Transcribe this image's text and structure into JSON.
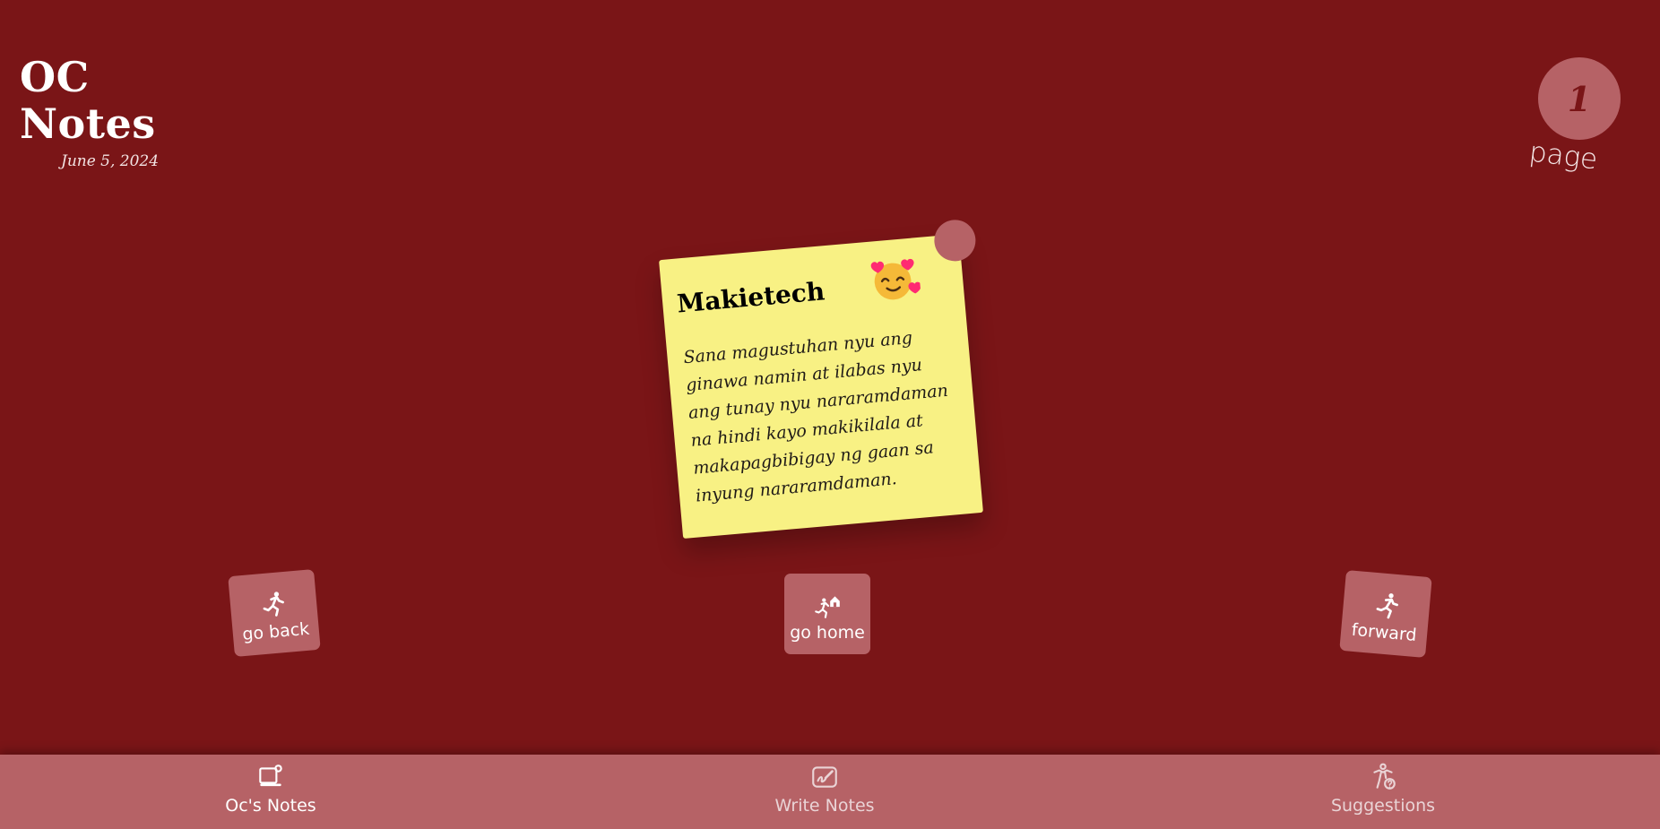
{
  "header": {
    "title": "OC Notes",
    "date": "June 5, 2024"
  },
  "page_indicator": {
    "number": "1",
    "label": "page"
  },
  "note": {
    "title": "Makietech",
    "emoji": "smiling-face-with-hearts",
    "body": "Sana magustuhan nyu ang ginawa namin at ilabas nyu ang tunay nyu nararamdaman na hindi kayo makikilala at makapagbibigay ng gaan sa inyung nararamdaman."
  },
  "nav_tiles": {
    "back": {
      "label": "go back",
      "icon": "running-person-icon"
    },
    "home": {
      "label": "go home",
      "icon": "running-home-icon"
    },
    "forward": {
      "label": "forward",
      "icon": "running-forward-icon"
    }
  },
  "bottom_nav": {
    "items": [
      {
        "label": "Oc's Notes",
        "icon": "notes-box-icon",
        "active": true
      },
      {
        "label": "Write Notes",
        "icon": "write-notes-icon",
        "active": false
      },
      {
        "label": "Suggestions",
        "icon": "suggestions-icon",
        "active": false
      }
    ]
  },
  "colors": {
    "background": "#7a1517",
    "accent": "#b66266",
    "note": "#f8f184",
    "text": "#ffffff"
  }
}
